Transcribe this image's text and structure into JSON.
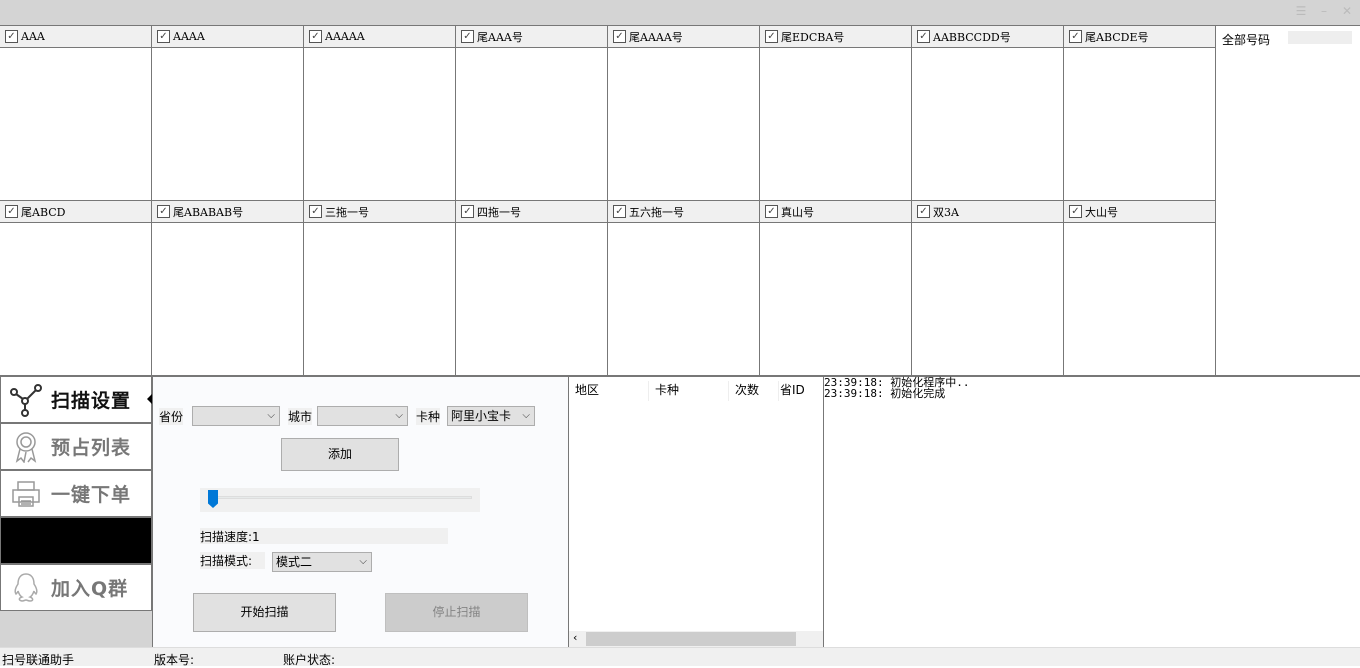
{
  "window": {
    "menu_icon": "menu-icon",
    "minimize_icon": "minimize-icon",
    "close_icon": "close-icon"
  },
  "categories_row1": [
    "AAA",
    "AAAA",
    "AAAAA",
    "尾AAA号",
    "尾AAAA号",
    "尾EDCBA号",
    "AABBCCDD号",
    "尾ABCDE号"
  ],
  "categories_row2": [
    "尾ABCD",
    "尾ABABAB号",
    "三拖一号",
    "四拖一号",
    "五六拖一号",
    "真山号",
    "双3A",
    "大山号"
  ],
  "all_numbers": {
    "label": "全部号码"
  },
  "sidebar": {
    "items": [
      {
        "label": "扫描设置",
        "icon": "network-icon",
        "active": true
      },
      {
        "label": "预占列表",
        "icon": "ribbon-icon"
      },
      {
        "label": "一键下单",
        "icon": "printer-icon"
      },
      {
        "label": ""
      },
      {
        "label": "加入Q群",
        "icon": "qq-icon"
      }
    ]
  },
  "settings": {
    "province_label": "省份",
    "province_value": "",
    "city_label": "城市",
    "city_value": "",
    "card_label": "卡种",
    "card_value": "阿里小宝卡",
    "add_button": "添加",
    "speed_slider_value": 1,
    "speed_label": "扫描速度:1",
    "mode_label": "扫描模式:",
    "mode_value": "模式二",
    "start_button": "开始扫描",
    "stop_button": "停止扫描",
    "accent": "#0078d7"
  },
  "table": {
    "columns": [
      "地区",
      "卡种",
      "次数",
      "省ID"
    ]
  },
  "log": {
    "lines": [
      "23:39:18: 初始化程序中..",
      "23:39:18: 初始化完成"
    ]
  },
  "status": {
    "app_name": "扫号联通助手",
    "version_label": "版本号:",
    "account_label": "账户状态:"
  }
}
